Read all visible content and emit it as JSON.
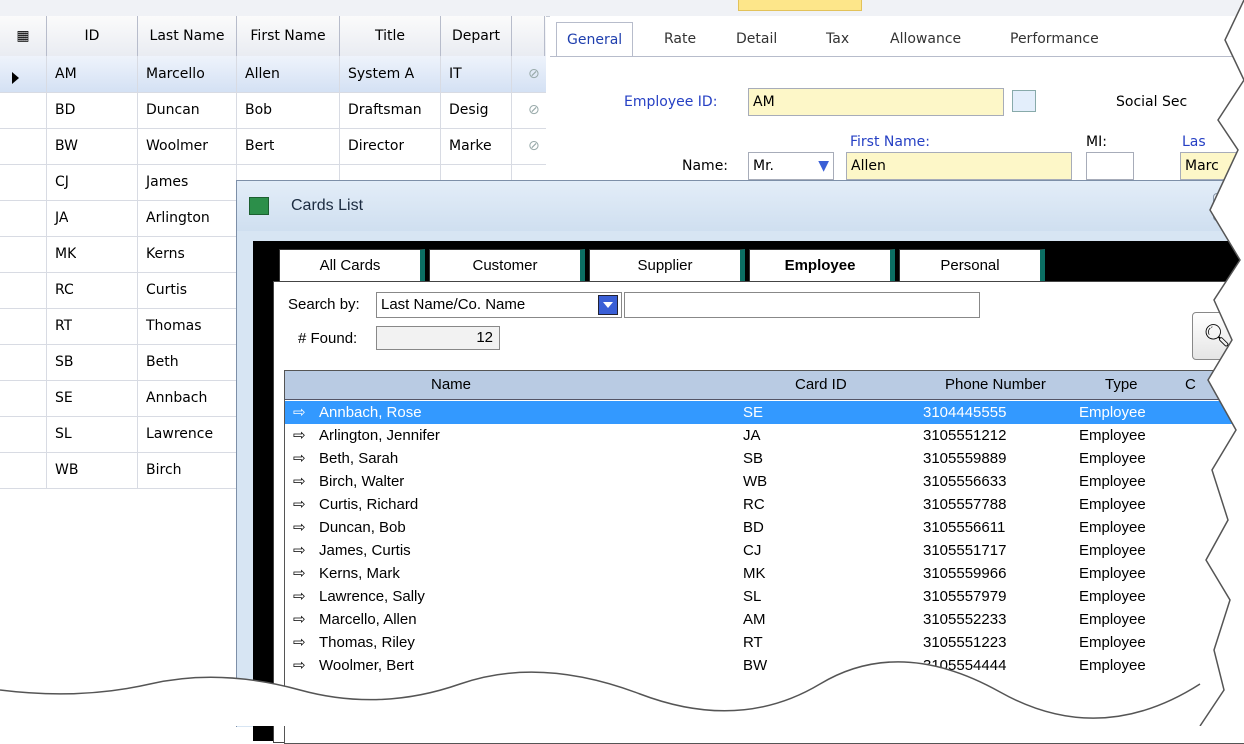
{
  "grid": {
    "columns": [
      "ID",
      "Last Name",
      "First Name",
      "Title",
      "Depart"
    ],
    "rows": [
      {
        "id": "AM",
        "last": "Marcello",
        "first": "Allen",
        "title": "System A",
        "dept": "IT",
        "clip": true,
        "selected": true
      },
      {
        "id": "BD",
        "last": "Duncan",
        "first": "Bob",
        "title": "Draftsman",
        "dept": "Desig",
        "clip": true
      },
      {
        "id": "BW",
        "last": "Woolmer",
        "first": "Bert",
        "title": "Director",
        "dept": "Marke",
        "clip": true
      },
      {
        "id": "CJ",
        "last": "James",
        "first": "",
        "title": "",
        "dept": ""
      },
      {
        "id": "JA",
        "last": "Arlington",
        "first": "",
        "title": "",
        "dept": ""
      },
      {
        "id": "MK",
        "last": "Kerns",
        "first": "",
        "title": "",
        "dept": ""
      },
      {
        "id": "RC",
        "last": "Curtis",
        "first": "",
        "title": "",
        "dept": ""
      },
      {
        "id": "RT",
        "last": "Thomas",
        "first": "",
        "title": "",
        "dept": ""
      },
      {
        "id": "SB",
        "last": "Beth",
        "first": "",
        "title": "",
        "dept": ""
      },
      {
        "id": "SE",
        "last": "Annbach",
        "first": "",
        "title": "",
        "dept": ""
      },
      {
        "id": "SL",
        "last": "Lawrence",
        "first": "",
        "title": "",
        "dept": ""
      },
      {
        "id": "WB",
        "last": "Birch",
        "first": "",
        "title": "",
        "dept": ""
      }
    ]
  },
  "form": {
    "tabs": [
      "General",
      "Rate",
      "Detail",
      "Tax",
      "Allowance",
      "Performance"
    ],
    "employee_id_label": "Employee ID:",
    "employee_id_value": "AM",
    "social_sec_label": "Social Sec",
    "first_name_label": "First Name:",
    "mi_label": "MI:",
    "last_label": "Las",
    "name_label": "Name:",
    "salutation": "Mr.",
    "first_name_value": "Allen",
    "last_name_value": "Marc"
  },
  "cards_window": {
    "title": "Cards List",
    "tabs": [
      "All Cards",
      "Customer",
      "Supplier",
      "Employee",
      "Personal"
    ],
    "active_tab": "Employee",
    "search_by_label": "Search by:",
    "search_by_value": "Last Name/Co. Name",
    "search_text": "",
    "found_label": "# Found:",
    "found_value": "12",
    "search_icon": "magnifier-icon",
    "list_columns": [
      "Name",
      "Card ID",
      "Phone Number",
      "Type",
      "C"
    ],
    "list_rows": [
      {
        "name": "Annbach, Rose",
        "id": "SE",
        "phone": "3104445555",
        "type": "Employee"
      },
      {
        "name": "Arlington, Jennifer",
        "id": "JA",
        "phone": "3105551212",
        "type": "Employee"
      },
      {
        "name": "Beth, Sarah",
        "id": "SB",
        "phone": "3105559889",
        "type": "Employee"
      },
      {
        "name": "Birch, Walter",
        "id": "WB",
        "phone": "3105556633",
        "type": "Employee"
      },
      {
        "name": "Curtis, Richard",
        "id": "RC",
        "phone": "3105557788",
        "type": "Employee"
      },
      {
        "name": "Duncan, Bob",
        "id": "BD",
        "phone": "3105556611",
        "type": "Employee"
      },
      {
        "name": "James, Curtis",
        "id": "CJ",
        "phone": "3105551717",
        "type": "Employee"
      },
      {
        "name": "Kerns, Mark",
        "id": "MK",
        "phone": "3105559966",
        "type": "Employee"
      },
      {
        "name": "Lawrence, Sally",
        "id": "SL",
        "phone": "3105557979",
        "type": "Employee"
      },
      {
        "name": "Marcello, Allen",
        "id": "AM",
        "phone": "3105552233",
        "type": "Employee"
      },
      {
        "name": "Thomas, Riley",
        "id": "RT",
        "phone": "3105551223",
        "type": "Employee"
      },
      {
        "name": "Woolmer, Bert",
        "id": "BW",
        "phone": "3105554444",
        "type": "Employee"
      }
    ]
  },
  "colors": {
    "selection": "#3399ff",
    "tab_accent": "#0b6e63",
    "field_bg": "#fdf7c8",
    "label_blue": "#2640c4"
  }
}
